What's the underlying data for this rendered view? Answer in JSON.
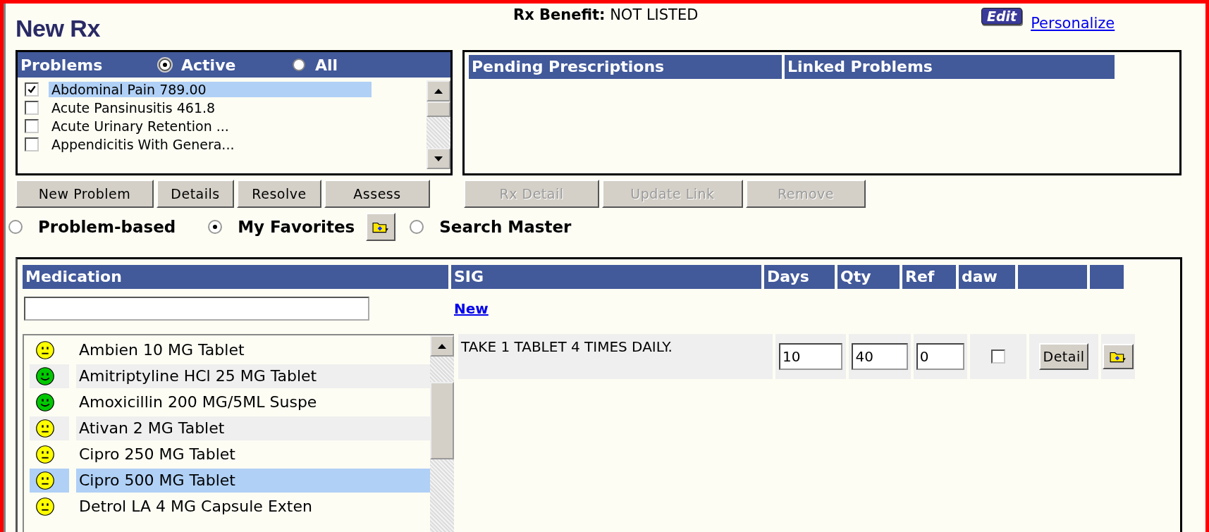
{
  "title": "New Rx",
  "rx_benefit": {
    "label": "Rx Benefit:",
    "value": "NOT LISTED"
  },
  "edit_badge": "Edit",
  "personalize_link": "Personalize",
  "problems": {
    "title": "Problems",
    "filters": [
      {
        "label": "Active",
        "selected": true
      },
      {
        "label": "All",
        "selected": false
      }
    ],
    "items": [
      {
        "label": "Abdominal Pain 789.00",
        "checked": true,
        "selected": true
      },
      {
        "label": "Acute Pansinusitis 461.8",
        "checked": false,
        "selected": false
      },
      {
        "label": "Acute Urinary Retention ...",
        "checked": false,
        "selected": false
      },
      {
        "label": "Appendicitis With Genera...",
        "checked": false,
        "selected": false
      }
    ]
  },
  "pending": {
    "columns": [
      "Pending Prescriptions",
      "Linked Problems"
    ]
  },
  "problem_buttons": [
    {
      "label": "New Problem",
      "disabled": false
    },
    {
      "label": "Details",
      "disabled": false
    },
    {
      "label": "Resolve",
      "disabled": false
    },
    {
      "label": "Assess",
      "disabled": false
    }
  ],
  "rx_buttons": [
    {
      "label": "Rx Detail",
      "disabled": true
    },
    {
      "label": "Update Link",
      "disabled": true
    },
    {
      "label": "Remove",
      "disabled": true
    }
  ],
  "source_options": [
    {
      "label": "Problem-based",
      "selected": false
    },
    {
      "label": "My Favorites",
      "selected": true,
      "folder_button": true
    },
    {
      "label": "Search Master",
      "selected": false
    }
  ],
  "medication": {
    "columns": [
      "Medication",
      "SIG",
      "Days",
      "Qty",
      "Ref",
      "daw"
    ],
    "sig_link": "New",
    "items": [
      {
        "name": "Ambien 10 MG Tablet",
        "kind": "neutral",
        "color": "#ffff00",
        "selected": false
      },
      {
        "name": "Amitriptyline HCl 25 MG Tablet",
        "kind": "happy",
        "color": "#00c800",
        "selected": false
      },
      {
        "name": "Amoxicillin 200 MG/5ML Suspe",
        "kind": "happy",
        "color": "#00c800",
        "selected": false
      },
      {
        "name": "Ativan 2 MG Tablet",
        "kind": "neutral",
        "color": "#ffff00",
        "selected": false
      },
      {
        "name": "Cipro 250 MG Tablet",
        "kind": "neutral",
        "color": "#ffff00",
        "selected": false
      },
      {
        "name": "Cipro 500 MG Tablet",
        "kind": "neutral",
        "color": "#ffff00",
        "selected": true
      },
      {
        "name": "Detrol LA 4 MG Capsule Exten",
        "kind": "neutral",
        "color": "#ffff00",
        "selected": false
      }
    ],
    "prescription": {
      "sig": "TAKE 1 TABLET 4 TIMES DAILY.",
      "days": "10",
      "qty": "40",
      "ref": "0",
      "daw": false,
      "detail_button": "Detail"
    }
  }
}
